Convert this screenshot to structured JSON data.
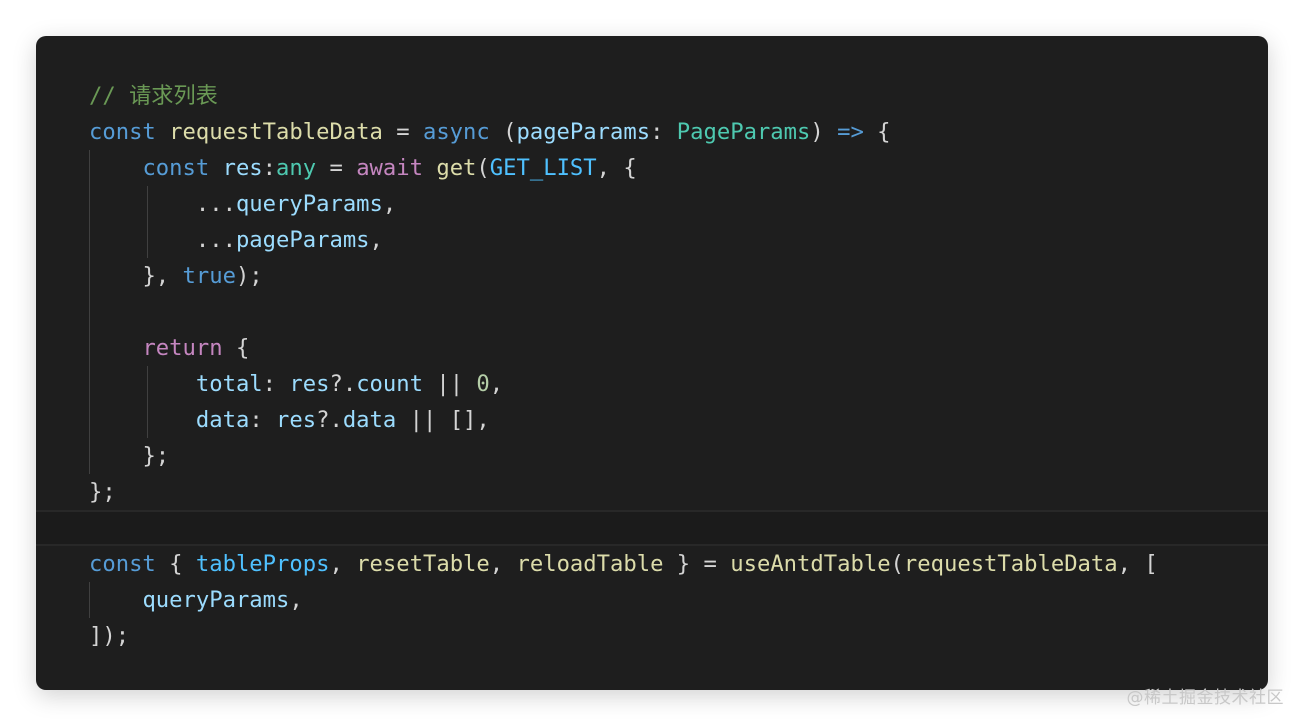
{
  "colors": {
    "background": "#1e1e1e",
    "keyword": "#569cd6",
    "control": "#c586c0",
    "function": "#dcdcaa",
    "variable": "#9cdcfe",
    "constant": "#4fc1ff",
    "type": "#4ec9b0",
    "number": "#b5cea8",
    "comment": "#6a9955"
  },
  "lines": [
    {
      "indent": 0,
      "tokens": [
        {
          "t": "// 请求列表",
          "c": "com"
        }
      ]
    },
    {
      "indent": 0,
      "tokens": [
        {
          "t": "const",
          "c": "kw"
        },
        {
          "t": " ",
          "c": "punc"
        },
        {
          "t": "requestTableData",
          "c": "fn"
        },
        {
          "t": " = ",
          "c": "punc"
        },
        {
          "t": "async",
          "c": "kw"
        },
        {
          "t": " (",
          "c": "punc"
        },
        {
          "t": "pageParams",
          "c": "var"
        },
        {
          "t": ": ",
          "c": "punc"
        },
        {
          "t": "PageParams",
          "c": "type"
        },
        {
          "t": ") ",
          "c": "punc"
        },
        {
          "t": "=>",
          "c": "kw"
        },
        {
          "t": " {",
          "c": "punc"
        }
      ]
    },
    {
      "indent": 1,
      "tokens": [
        {
          "t": "const",
          "c": "kw"
        },
        {
          "t": " ",
          "c": "punc"
        },
        {
          "t": "res",
          "c": "var"
        },
        {
          "t": ":",
          "c": "punc"
        },
        {
          "t": "any",
          "c": "type"
        },
        {
          "t": " = ",
          "c": "punc"
        },
        {
          "t": "await",
          "c": "ctl"
        },
        {
          "t": " ",
          "c": "punc"
        },
        {
          "t": "get",
          "c": "fn"
        },
        {
          "t": "(",
          "c": "punc"
        },
        {
          "t": "GET_LIST",
          "c": "const"
        },
        {
          "t": ", {",
          "c": "punc"
        }
      ]
    },
    {
      "indent": 2,
      "tokens": [
        {
          "t": "...",
          "c": "punc"
        },
        {
          "t": "queryParams",
          "c": "var"
        },
        {
          "t": ",",
          "c": "punc"
        }
      ]
    },
    {
      "indent": 2,
      "tokens": [
        {
          "t": "...",
          "c": "punc"
        },
        {
          "t": "pageParams",
          "c": "var"
        },
        {
          "t": ",",
          "c": "punc"
        }
      ]
    },
    {
      "indent": 1,
      "tokens": [
        {
          "t": "}, ",
          "c": "punc"
        },
        {
          "t": "true",
          "c": "bool"
        },
        {
          "t": ");",
          "c": "punc"
        }
      ]
    },
    {
      "indent": 1,
      "tokens": []
    },
    {
      "indent": 1,
      "tokens": [
        {
          "t": "return",
          "c": "ctl"
        },
        {
          "t": " {",
          "c": "punc"
        }
      ]
    },
    {
      "indent": 2,
      "tokens": [
        {
          "t": "total",
          "c": "var"
        },
        {
          "t": ": ",
          "c": "punc"
        },
        {
          "t": "res",
          "c": "var"
        },
        {
          "t": "?.",
          "c": "punc"
        },
        {
          "t": "count",
          "c": "var"
        },
        {
          "t": " || ",
          "c": "punc"
        },
        {
          "t": "0",
          "c": "num"
        },
        {
          "t": ",",
          "c": "punc"
        }
      ]
    },
    {
      "indent": 2,
      "tokens": [
        {
          "t": "data",
          "c": "var"
        },
        {
          "t": ": ",
          "c": "punc"
        },
        {
          "t": "res",
          "c": "var"
        },
        {
          "t": "?.",
          "c": "punc"
        },
        {
          "t": "data",
          "c": "var"
        },
        {
          "t": " || [],",
          "c": "punc"
        }
      ]
    },
    {
      "indent": 1,
      "tokens": [
        {
          "t": "};",
          "c": "punc"
        }
      ]
    },
    {
      "indent": 0,
      "tokens": [
        {
          "t": "};",
          "c": "punc"
        }
      ]
    },
    {
      "indent": 0,
      "active": true,
      "tokens": []
    },
    {
      "indent": 0,
      "tokens": [
        {
          "t": "const",
          "c": "kw"
        },
        {
          "t": " { ",
          "c": "punc"
        },
        {
          "t": "tableProps",
          "c": "const"
        },
        {
          "t": ", ",
          "c": "punc"
        },
        {
          "t": "resetTable",
          "c": "fn"
        },
        {
          "t": ", ",
          "c": "punc"
        },
        {
          "t": "reloadTable",
          "c": "fn"
        },
        {
          "t": " } = ",
          "c": "punc"
        },
        {
          "t": "useAntdTable",
          "c": "fn"
        },
        {
          "t": "(",
          "c": "punc"
        },
        {
          "t": "requestTableData",
          "c": "fn"
        },
        {
          "t": ", [",
          "c": "punc"
        }
      ]
    },
    {
      "indent": 1,
      "tokens": [
        {
          "t": "queryParams",
          "c": "var"
        },
        {
          "t": ",",
          "c": "punc"
        }
      ]
    },
    {
      "indent": 0,
      "tokens": [
        {
          "t": "]);",
          "c": "punc"
        }
      ]
    }
  ],
  "watermark": "@稀土掘金技术社区"
}
